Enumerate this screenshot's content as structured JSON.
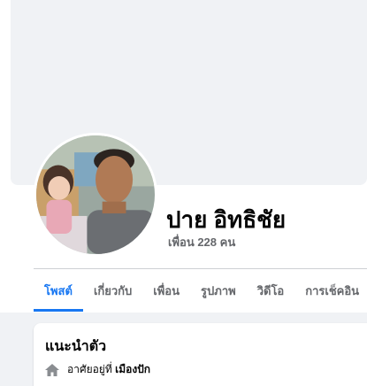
{
  "profile": {
    "name": "ปาย อิทธิชัย",
    "friends_text": "เพื่อน 228 คน"
  },
  "tabs": [
    {
      "label": "โพสต์",
      "active": true
    },
    {
      "label": "เกี่ยวกับ",
      "active": false
    },
    {
      "label": "เพื่อน",
      "active": false
    },
    {
      "label": "รูปภาพ",
      "active": false
    },
    {
      "label": "วิดีโอ",
      "active": false
    },
    {
      "label": "การเช็คอิน",
      "active": false
    }
  ],
  "intro": {
    "title": "แนะนำตัว",
    "lives_in_prefix": "อาศัยอยู่ที่",
    "lives_in_place": "เมืองปัก",
    "icon": "home-icon"
  },
  "colors": {
    "accent": "#1877f2",
    "background": "#f0f2f5",
    "secondary_text": "#65676b"
  }
}
